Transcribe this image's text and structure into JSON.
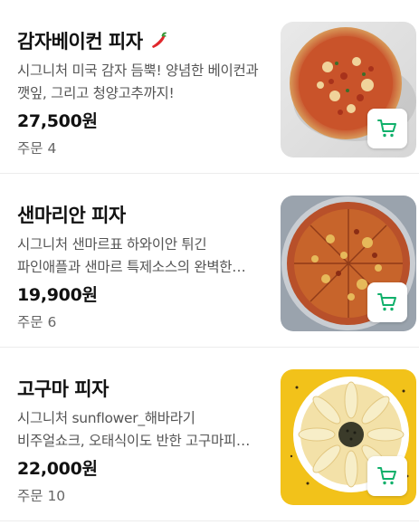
{
  "menu_items": [
    {
      "name": "감자베이컨 피자",
      "spicy_icon": "chili-pepper-icon",
      "description": "시그니처 미국 감자 듬뿍! 양념한 베이컨과 깻잎, 그리고 청양고추까지!",
      "price": "27,500원",
      "orders": "주문 4"
    },
    {
      "name": "샌마리안 피자",
      "description": "시그니처 샌마르표 하와이안 튀긴 파인애플과 샌마르 특제소스의 완벽한 조화",
      "price": "19,900원",
      "orders": "주문 6"
    },
    {
      "name": "고구마 피자",
      "description": "시그니처 sunflower_해바라기 비주얼쇼크, 오태식이도 반한 고구마피자 맛집",
      "price": "22,000원",
      "orders": "주문 10"
    }
  ],
  "icons": {
    "cart": "shopping-cart-icon"
  },
  "colors": {
    "accent": "#10b06b",
    "description": "#555555",
    "divider": "#ececec"
  }
}
